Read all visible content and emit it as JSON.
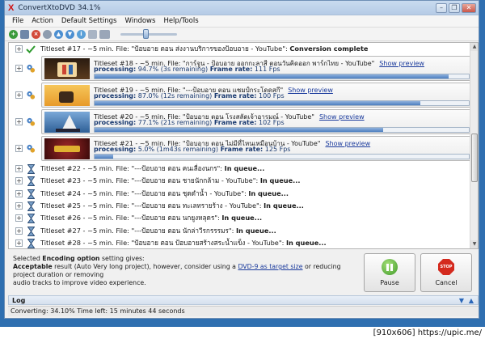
{
  "window": {
    "title": "ConvertXtoDVD 34.1%",
    "controls": [
      "–",
      "❐",
      "✕"
    ]
  },
  "menu": [
    "File",
    "Action",
    "Default Settings",
    "Windows",
    "Help/Tools"
  ],
  "toolbar": {
    "zoom_level": 0.45
  },
  "list": {
    "completed": {
      "prefix": "Titleset #17 - ~5 min. File: \"ป้อบอาย ตอน ส่งงานบริการของป้อบอาย - YouTube\": ",
      "status": "Conversion complete"
    },
    "processing": [
      {
        "line1": "Titleset #18 - ~5 min. File: \"การ์จูน - ป้อบอาย ออกกะลาสี ตอนวันคิดออก พาร์กไทย - YouTube\"",
        "link": "Show preview",
        "label": "processing:",
        "detail": " 94.7% (3s remaining) ",
        "fps_label": "Frame rate:",
        "fps": " 111 Fps",
        "progress": 0.947,
        "thumb": "dancers"
      },
      {
        "line1": "Titleset #19 - ~5 min. File: \"---ป้อบอาย ตอน แชมป์กระโดดสกี\"",
        "link": "Show preview",
        "label": "processing:",
        "detail": " 87.0% (12s remaining) ",
        "fps_label": "Frame rate:",
        "fps": " 100 Fps",
        "progress": 0.87,
        "thumb": "sky"
      },
      {
        "line1": "Titleset #20 - ~5 min. File: \"ป้อบอาย ตอน โรงสลัดเจ้าอารมณ์ - YouTube\"",
        "link": "Show preview",
        "label": "processing:",
        "detail": " 77.1% (21s remaining) ",
        "fps_label": "Frame rate:",
        "fps": " 102 Fps",
        "progress": 0.771,
        "thumb": "ship"
      },
      {
        "line1": "Titleset #21 - ~5 min. File: \"ป้อบอาย ตอน ไม่มีที่ไหนเหมือนบ้าน - YouTube\"",
        "link": "Show preview",
        "label": "processing:",
        "detail": " 5.0% (1m43s remaining) ",
        "fps_label": "Frame rate:",
        "fps": " 125 Fps",
        "progress": 0.05,
        "thumb": "title"
      }
    ],
    "queued": [
      {
        "prefix": "Titleset #22 - ~5 min. File: \"---ป้อบอาย ตอน คนเลื่องนกร\": ",
        "status": "In queue..."
      },
      {
        "prefix": "Titleset #23 - ~5 min. File: \"---ป้อบอาย ตอน ชายนักกล้าม - YouTube\": ",
        "status": "In queue..."
      },
      {
        "prefix": "Titleset #24 - ~5 min. File: \"---ป้อบอาย ตอน ชุดดำน้ำ - YouTube\": ",
        "status": "In queue..."
      },
      {
        "prefix": "Titleset #25 - ~5 min. File: \"---ป้อบอาย ตอน ทะเลทรายร้าง - YouTube\": ",
        "status": "In queue..."
      },
      {
        "prefix": "Titleset #26 - ~5 min. File: \"---ป้อบอาย ตอน นกยูงหลุดร\": ",
        "status": "In queue..."
      },
      {
        "prefix": "Titleset #27 - ~5 min. File: \"---ป้อบอาย ตอน นักล่าวีรกรรรมร\": ",
        "status": "In queue..."
      },
      {
        "prefix": "Titleset #28 - ~5 min. File: \"ป้อบอาย ตอน ป้อบอายสร้างสระน้ำแข็ง - YouTube\": ",
        "status": "In queue..."
      }
    ]
  },
  "info": {
    "line1_a": "Selected ",
    "line1_bold": "Encoding option",
    "line1_b": " setting gives:",
    "line2_bold": "Acceptable",
    "line2_a": " result (Auto Very long project), however, consider using a ",
    "line2_link": "DVD-9 as target size",
    "line2_b": " or reducing project duration or removing",
    "line3": "audio tracks to improve video experience."
  },
  "buttons": {
    "pause": "Pause",
    "cancel": "Cancel",
    "stop_icon_text": "STOP"
  },
  "log": {
    "label": "Log"
  },
  "status": {
    "text": "Converting: 34.10% Time left: 15 minutes 44 seconds"
  },
  "watermark": "[910x606] https://upic.me/"
}
